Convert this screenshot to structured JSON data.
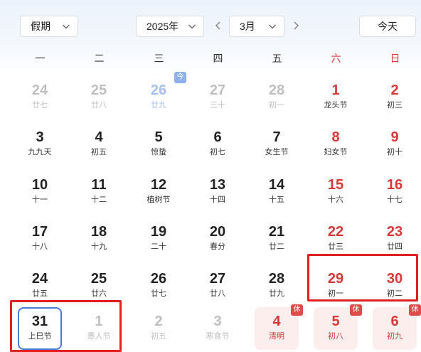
{
  "toolbar": {
    "holiday_select": "假期",
    "year_select": "2025年",
    "month_select": "3月",
    "today_button": "今天"
  },
  "weekdays": [
    "一",
    "二",
    "三",
    "四",
    "五",
    "六",
    "日"
  ],
  "badges": {
    "rest": "休",
    "today": "今"
  },
  "colors": {
    "weekend_red": "#d9383a",
    "rest_badge": "#e04a4a",
    "today_ring": "#4a7bd8",
    "annotation_red": "#e02020"
  },
  "weeks": [
    [
      {
        "day": "24",
        "lunar": "廿七",
        "state": "other"
      },
      {
        "day": "25",
        "lunar": "廿八",
        "state": "other"
      },
      {
        "day": "26",
        "lunar": "廿九",
        "state": "other-today"
      },
      {
        "day": "27",
        "lunar": "三十",
        "state": "other"
      },
      {
        "day": "28",
        "lunar": "初一",
        "state": "other"
      },
      {
        "day": "1",
        "lunar": "龙头节",
        "state": "weekend"
      },
      {
        "day": "2",
        "lunar": "初三",
        "state": "weekend"
      }
    ],
    [
      {
        "day": "3",
        "lunar": "九九天",
        "state": "normal"
      },
      {
        "day": "4",
        "lunar": "初五",
        "state": "normal"
      },
      {
        "day": "5",
        "lunar": "惊蛰",
        "state": "normal"
      },
      {
        "day": "6",
        "lunar": "初七",
        "state": "normal"
      },
      {
        "day": "7",
        "lunar": "女生节",
        "state": "normal"
      },
      {
        "day": "8",
        "lunar": "妇女节",
        "state": "weekend"
      },
      {
        "day": "9",
        "lunar": "初十",
        "state": "weekend"
      }
    ],
    [
      {
        "day": "10",
        "lunar": "十一",
        "state": "normal"
      },
      {
        "day": "11",
        "lunar": "十二",
        "state": "normal"
      },
      {
        "day": "12",
        "lunar": "植树节",
        "state": "normal"
      },
      {
        "day": "13",
        "lunar": "十四",
        "state": "normal"
      },
      {
        "day": "14",
        "lunar": "十五",
        "state": "normal"
      },
      {
        "day": "15",
        "lunar": "十六",
        "state": "weekend"
      },
      {
        "day": "16",
        "lunar": "十七",
        "state": "weekend"
      }
    ],
    [
      {
        "day": "17",
        "lunar": "十八",
        "state": "normal"
      },
      {
        "day": "18",
        "lunar": "十九",
        "state": "normal"
      },
      {
        "day": "19",
        "lunar": "二十",
        "state": "normal"
      },
      {
        "day": "20",
        "lunar": "春分",
        "state": "normal"
      },
      {
        "day": "21",
        "lunar": "廿二",
        "state": "normal"
      },
      {
        "day": "22",
        "lunar": "廿三",
        "state": "weekend"
      },
      {
        "day": "23",
        "lunar": "廿四",
        "state": "weekend"
      }
    ],
    [
      {
        "day": "24",
        "lunar": "廿五",
        "state": "normal"
      },
      {
        "day": "25",
        "lunar": "廿六",
        "state": "normal"
      },
      {
        "day": "26",
        "lunar": "廿七",
        "state": "normal"
      },
      {
        "day": "27",
        "lunar": "廿八",
        "state": "normal"
      },
      {
        "day": "28",
        "lunar": "廿九",
        "state": "normal"
      },
      {
        "day": "29",
        "lunar": "初一",
        "state": "weekend"
      },
      {
        "day": "30",
        "lunar": "初二",
        "state": "weekend"
      }
    ],
    [
      {
        "day": "31",
        "lunar": "上巳节",
        "state": "selected"
      },
      {
        "day": "1",
        "lunar": "愚人节",
        "state": "other"
      },
      {
        "day": "2",
        "lunar": "初五",
        "state": "other"
      },
      {
        "day": "3",
        "lunar": "寒食节",
        "state": "other"
      },
      {
        "day": "4",
        "lunar": "清明",
        "state": "holiday"
      },
      {
        "day": "5",
        "lunar": "初八",
        "state": "holiday"
      },
      {
        "day": "6",
        "lunar": "初九",
        "state": "holiday"
      }
    ]
  ]
}
